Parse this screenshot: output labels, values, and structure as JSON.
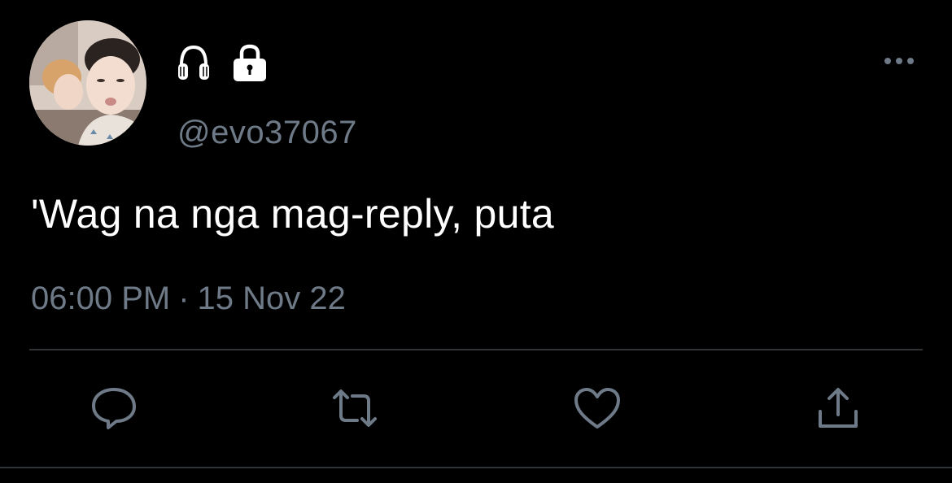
{
  "user": {
    "handle": "@evo37067",
    "badges": [
      "headphones-icon",
      "lock-icon"
    ]
  },
  "tweet": {
    "text": "'Wag na nga mag-reply, puta",
    "time": "06:00 PM",
    "separator": "·",
    "date": "15 Nov 22"
  },
  "actions": [
    "reply-icon",
    "retweet-icon",
    "like-icon",
    "share-icon"
  ],
  "colors": {
    "background": "#000000",
    "text": "#ffffff",
    "secondary": "#6e7a87",
    "divider": "#2f3336"
  }
}
